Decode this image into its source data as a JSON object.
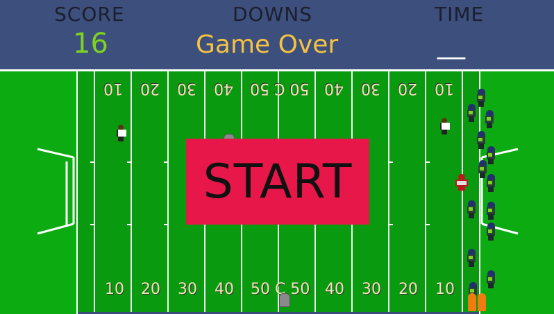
{
  "hud": {
    "score_label": "SCORE",
    "score_value": "16",
    "downs_label": "DOWNS",
    "downs_value": "Game Over",
    "time_label": "TIME",
    "time_value": "__"
  },
  "field": {
    "top_yard_numbers": [
      "10",
      "20",
      "30",
      "40",
      "50 C 50",
      "40",
      "30",
      "20",
      "10"
    ],
    "bottom_yard_numbers": [
      "10",
      "20",
      "30",
      "40",
      "50 C 50",
      "40",
      "30",
      "20",
      "10"
    ]
  },
  "start_button": {
    "label": "START"
  },
  "colors": {
    "hud_bg": "#3d4f7c",
    "score": "#7ed321",
    "downs": "#f5c242",
    "field": "#0a9a10",
    "start": "#e8174a"
  }
}
